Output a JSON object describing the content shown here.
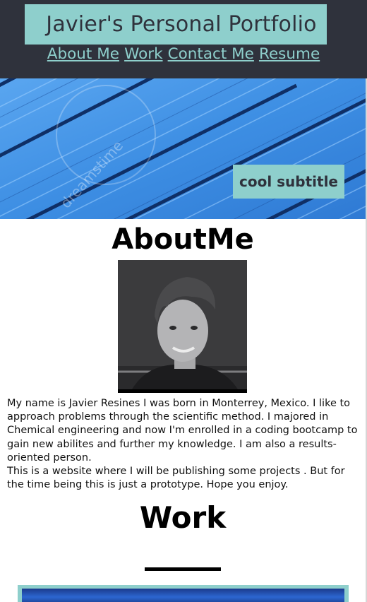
{
  "header": {
    "title": "Javier's Personal Portfolio",
    "nav": [
      "About Me",
      "Work",
      "Contact Me",
      "Resume"
    ]
  },
  "hero": {
    "subtitle": "cool subtitle",
    "watermark": "dreamstime"
  },
  "about": {
    "heading": "AboutMe",
    "paragraph1": "My name is Javier Resines I was born in Monterrey, Mexico. I like to approach problems through the scientific method. I majored in Chemical engineering and now I'm enrolled in a coding bootcamp to gain new abilites and further my knowledge. I am also a results-oriented person.",
    "paragraph2": "This is a website where I will be publishing some projects . But for the time being this is just a prototype. Hope you enjoy."
  },
  "work": {
    "heading": "Work"
  },
  "colors": {
    "header_bg": "#2f323c",
    "accent": "#8ecfcc",
    "hero_blue": "#3d8ee3"
  }
}
